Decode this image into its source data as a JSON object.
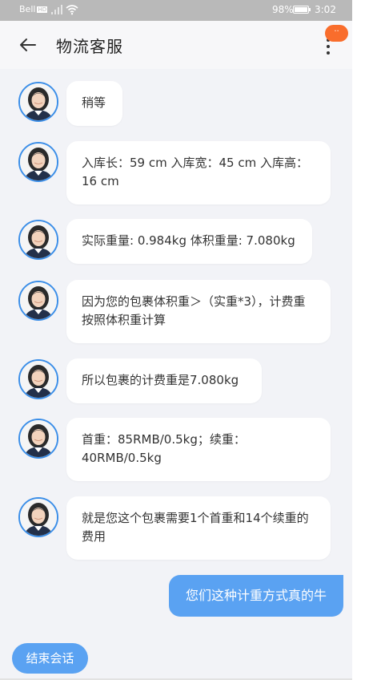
{
  "status_bar": {
    "carrier": "Bell",
    "network_badge": "HD",
    "battery_percent": "98%",
    "battery_level": 0.98,
    "time": "3:02"
  },
  "header": {
    "title": "物流客服",
    "notification_badge": "··"
  },
  "messages": [
    {
      "from": "agent",
      "text": "稍等"
    },
    {
      "from": "agent",
      "text": "入库长：59 cm 入库宽：45 cm 入库高：16 cm"
    },
    {
      "from": "agent",
      "text": "实际重量: 0.984kg 体积重量: 7.080kg"
    },
    {
      "from": "agent",
      "text": "因为您的包裹体积重＞（实重*3），计费重按照体积重计算"
    },
    {
      "from": "agent",
      "text": "所以包裹的计费重是7.080kg"
    },
    {
      "from": "agent",
      "text": "首重：85RMB/0.5kg；续重：40RMB/0.5kg"
    },
    {
      "from": "agent",
      "text": "就是您这个包裹需要1个首重和14个续重的费用"
    },
    {
      "from": "user",
      "text": "您们这种计重方式真的牛"
    }
  ],
  "actions": {
    "end_session_label": "结束会话"
  },
  "colors": {
    "accent": "#5aa2f2",
    "badge": "#f96d2c",
    "background": "#f2f3f7"
  }
}
